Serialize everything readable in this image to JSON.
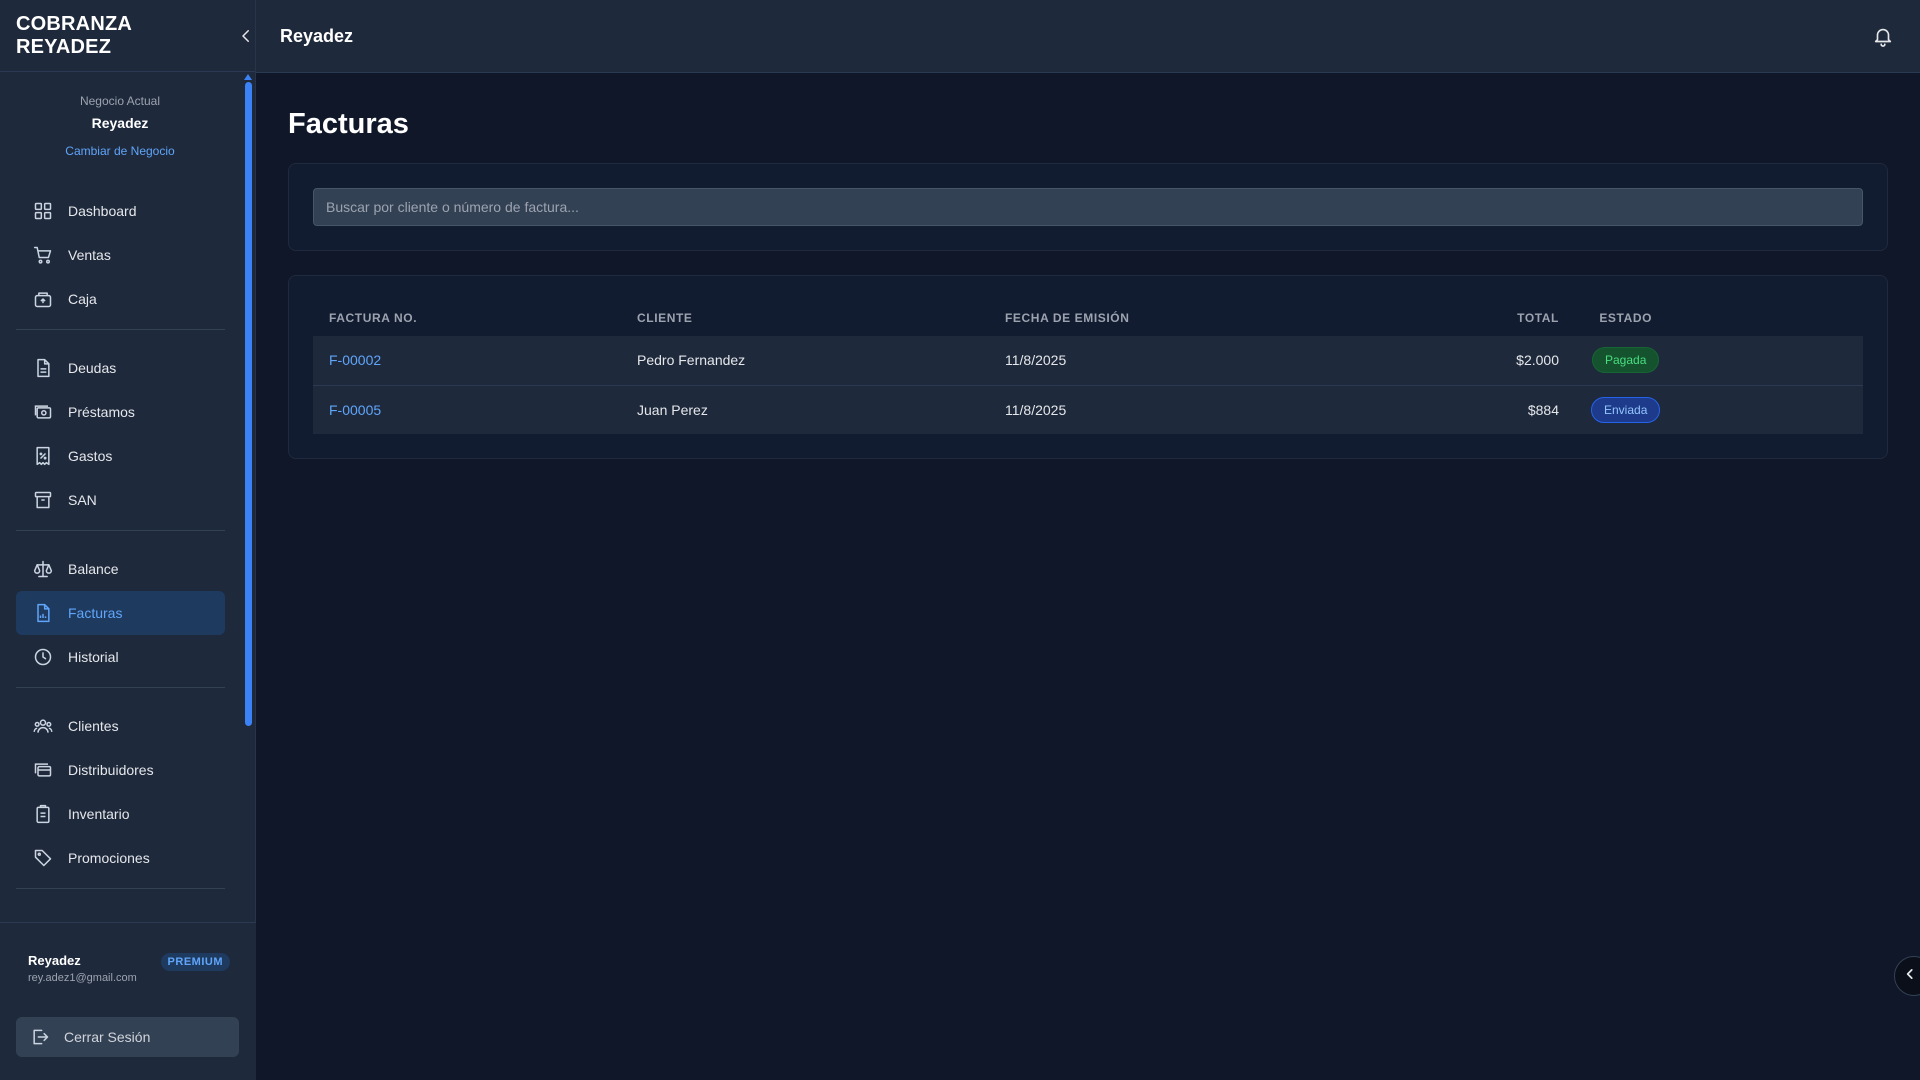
{
  "app": {
    "brand": "COBRANZA REYADEZ",
    "header_title": "Reyadez"
  },
  "business": {
    "label": "Negocio Actual",
    "name": "Reyadez",
    "change_link": "Cambiar de Negocio"
  },
  "nav": {
    "group1": [
      {
        "label": "Dashboard",
        "icon": "grid-icon"
      },
      {
        "label": "Ventas",
        "icon": "cart-icon"
      },
      {
        "label": "Caja",
        "icon": "cash-register-icon"
      }
    ],
    "group2": [
      {
        "label": "Deudas",
        "icon": "document-icon"
      },
      {
        "label": "Préstamos",
        "icon": "banknote-icon"
      },
      {
        "label": "Gastos",
        "icon": "receipt-icon"
      },
      {
        "label": "SAN",
        "icon": "archive-icon"
      }
    ],
    "group3": [
      {
        "label": "Balance",
        "icon": "scale-icon"
      },
      {
        "label": "Facturas",
        "icon": "invoice-chart-icon",
        "active": true
      },
      {
        "label": "Historial",
        "icon": "clock-icon"
      }
    ],
    "group4": [
      {
        "label": "Clientes",
        "icon": "users-icon"
      },
      {
        "label": "Distribuidores",
        "icon": "cards-icon"
      },
      {
        "label": "Inventario",
        "icon": "clipboard-icon"
      },
      {
        "label": "Promociones",
        "icon": "tag-icon"
      }
    ]
  },
  "user": {
    "name": "Reyadez",
    "email": "rey.adez1@gmail.com",
    "plan": "PREMIUM",
    "logout_label": "Cerrar Sesión"
  },
  "page": {
    "title": "Facturas",
    "search_placeholder": "Buscar por cliente o número de factura..."
  },
  "table": {
    "headers": [
      "FACTURA NO.",
      "CLIENTE",
      "FECHA DE EMISIÓN",
      "TOTAL",
      "ESTADO"
    ],
    "rows": [
      {
        "number": "F-00002",
        "client": "Pedro Fernandez",
        "date": "11/8/2025",
        "total": "$2.000",
        "status": "Pagada",
        "status_color": "#4ade80"
      },
      {
        "number": "F-00005",
        "client": "Juan Perez",
        "date": "11/8/2025",
        "total": "$884",
        "status": "Enviada",
        "status_color": "#93c5fd"
      }
    ]
  },
  "colors": {
    "accent": "#3b82f6",
    "link": "#60a5fa",
    "background": "#0f1729",
    "panel": "#1e293b"
  }
}
